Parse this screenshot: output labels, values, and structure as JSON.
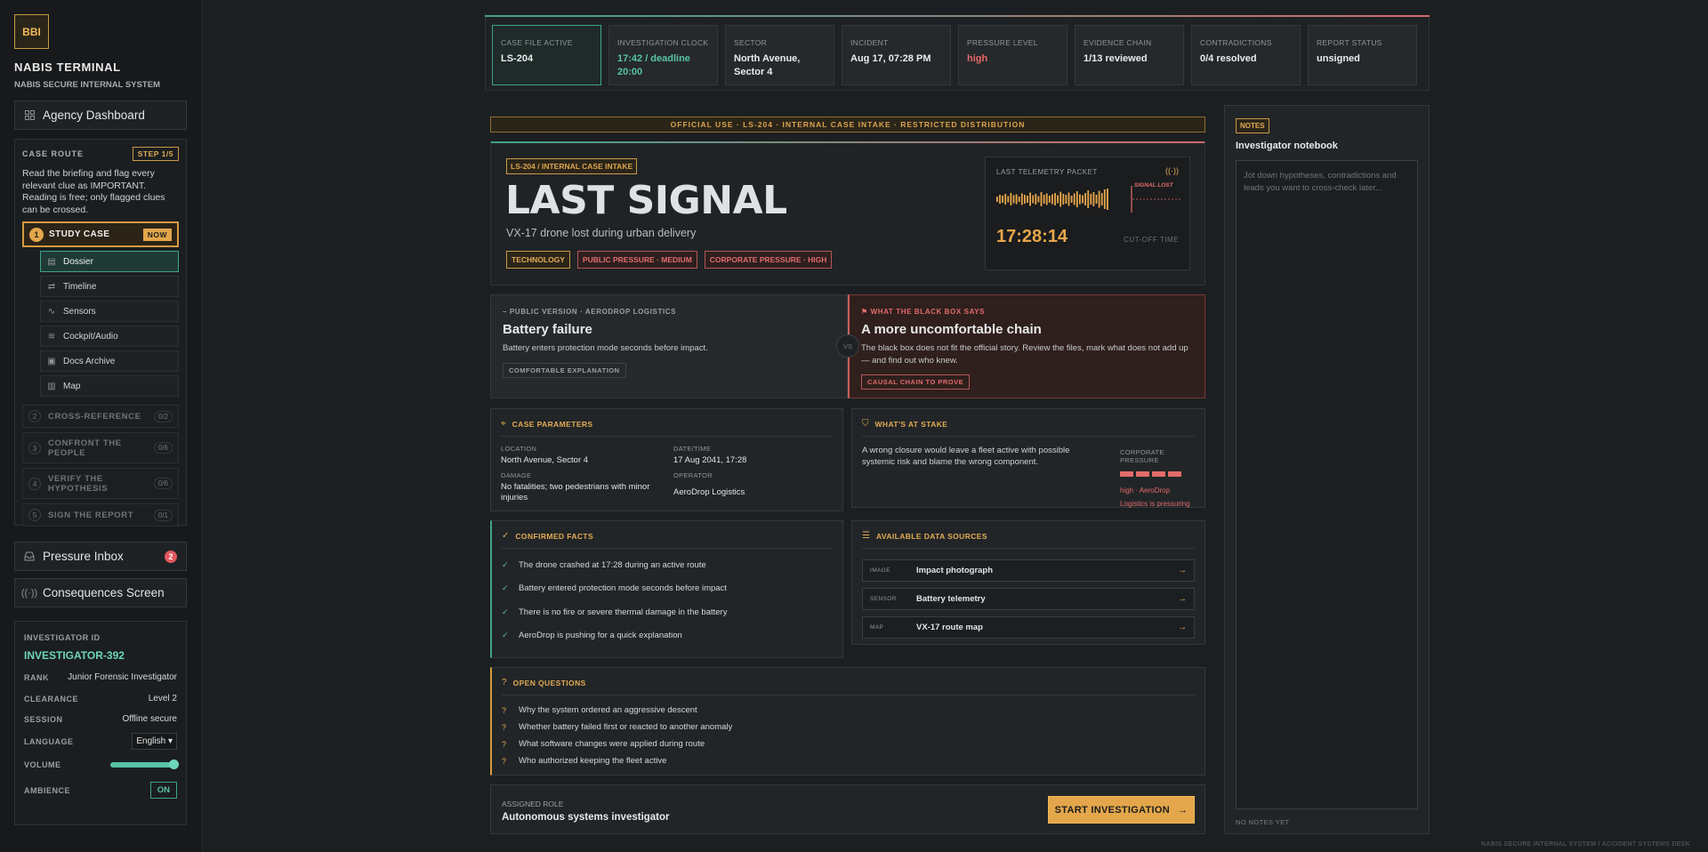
{
  "app": {
    "logo": "BBI",
    "title": "NABIS TERMINAL",
    "subtitle": "NABIS SECURE INTERNAL SYSTEM",
    "footer": "NABIS SECURE INTERNAL SYSTEM / ACCIDENT SYSTEMS DESK"
  },
  "sidebar": {
    "agency_dashboard": "Agency Dashboard",
    "pressure_inbox": "Pressure Inbox",
    "pressure_inbox_count": "2",
    "consequences": "Consequences Screen",
    "case_route": {
      "label": "CASE ROUTE",
      "step_badge": "STEP 1/5",
      "description": "Read the briefing and flag every relevant clue as IMPORTANT. Reading is free; only flagged clues can be crossed.",
      "active_step": {
        "num": "1",
        "label": "STUDY CASE",
        "badge": "NOW"
      },
      "subitems": [
        {
          "label": "Dossier"
        },
        {
          "label": "Timeline"
        },
        {
          "label": "Sensors"
        },
        {
          "label": "Cockpit/Audio"
        },
        {
          "label": "Docs Archive"
        },
        {
          "label": "Map"
        }
      ],
      "locked_steps": [
        {
          "num": "2",
          "label": "CROSS-REFERENCE",
          "count": "0/2"
        },
        {
          "num": "3",
          "label": "CONFRONT THE PEOPLE",
          "count": "0/6"
        },
        {
          "num": "4",
          "label": "VERIFY THE HYPOTHESIS",
          "count": "0/6"
        },
        {
          "num": "5",
          "label": "SIGN THE REPORT",
          "count": "0/1"
        }
      ]
    },
    "investigator": {
      "id_label": "INVESTIGATOR ID",
      "id": "INVESTIGATOR-392",
      "rank_label": "RANK",
      "rank": "Junior Forensic Investigator",
      "clearance_label": "CLEARANCE",
      "clearance": "Level 2",
      "session_label": "SESSION",
      "session": "Offline secure",
      "language_label": "LANGUAGE",
      "language": "English",
      "volume_label": "VOLUME",
      "volume": 1.0,
      "ambience_label": "AMBIENCE",
      "ambience": "ON"
    }
  },
  "topbar": [
    {
      "key": "CASE FILE ACTIVE",
      "value": "LS-204",
      "style": "normal"
    },
    {
      "key": "INVESTIGATION CLOCK",
      "value": "17:42 / deadline 20:00",
      "style": "teal"
    },
    {
      "key": "SECTOR",
      "value": "North Avenue, Sector 4",
      "style": "normal"
    },
    {
      "key": "INCIDENT",
      "value": "Aug 17, 07:28 PM",
      "style": "normal"
    },
    {
      "key": "PRESSURE LEVEL",
      "value": "high",
      "style": "red"
    },
    {
      "key": "EVIDENCE CHAIN",
      "value": "1/13 reviewed",
      "style": "normal"
    },
    {
      "key": "CONTRADICTIONS",
      "value": "0/4 resolved",
      "style": "normal"
    },
    {
      "key": "REPORT STATUS",
      "value": "unsigned",
      "style": "normal"
    }
  ],
  "banner": "OFFICIAL USE · LS-204 · INTERNAL CASE INTAKE · RESTRICTED DISTRIBUTION",
  "hero": {
    "tag": "LS-204 / INTERNAL CASE INTAKE",
    "title": "LAST SIGNAL",
    "subtitle": "VX-17 drone lost during urban delivery",
    "tags": [
      "TECHNOLOGY",
      "PUBLIC PRESSURE · MEDIUM",
      "CORPORATE PRESSURE · HIGH"
    ],
    "telemetry": {
      "label": "LAST TELEMETRY PACKET",
      "lost": "SIGNAL LOST",
      "time": "17:28:14",
      "cut_label": "CUT-OFF TIME"
    }
  },
  "versions": {
    "public": {
      "kicker": "PUBLIC VERSION · AERODROP LOGISTICS",
      "title": "Battery failure",
      "text": "Battery enters protection mode seconds before impact.",
      "pill": "COMFORTABLE EXPLANATION"
    },
    "vs": "VS",
    "blackbox": {
      "kicker": "WHAT THE BLACK BOX SAYS",
      "title": "A more uncomfortable chain",
      "text": "The black box does not fit the official story. Review the files, mark what does not add up — and find out who knew.",
      "pill": "CAUSAL CHAIN TO PROVE"
    }
  },
  "case_parameters": {
    "title": "CASE PARAMETERS",
    "location_label": "LOCATION",
    "location": "North Avenue, Sector 4",
    "datetime_label": "DATE/TIME",
    "datetime": "17 Aug 2041, 17:28",
    "damage_label": "DAMAGE",
    "damage": "No fatalities; two pedestrians with minor injuries",
    "operator_label": "OPERATOR",
    "operator": "AeroDrop Logistics"
  },
  "stake": {
    "title": "WHAT'S AT STAKE",
    "text": "A wrong closure would leave a fleet active with possible systemic risk and blame the wrong component.",
    "pressure_label": "CORPORATE PRESSURE",
    "pressure_level": 4,
    "pressure_max": 4,
    "pressure_text": "high · AeroDrop Logistics is pressuring"
  },
  "facts": {
    "title": "CONFIRMED FACTS",
    "items": [
      "The drone crashed at 17:28 during an active route",
      "Battery entered protection mode seconds before impact",
      "There is no fire or severe thermal damage in the battery",
      "AeroDrop is pushing for a quick explanation"
    ]
  },
  "sources": {
    "title": "AVAILABLE DATA SOURCES",
    "items": [
      {
        "kind": "IMAGE",
        "label": "Impact photograph"
      },
      {
        "kind": "SENSOR",
        "label": "Battery telemetry"
      },
      {
        "kind": "MAP",
        "label": "VX-17 route map"
      }
    ]
  },
  "questions": {
    "title": "OPEN QUESTIONS",
    "items": [
      "Why the system ordered an aggressive descent",
      "Whether battery failed first or reacted to another anomaly",
      "What software changes were applied during route",
      "Who authorized keeping the fleet active"
    ]
  },
  "role": {
    "label": "ASSIGNED ROLE",
    "value": "Autonomous systems investigator",
    "start": "START INVESTIGATION"
  },
  "notes": {
    "tag": "NOTES",
    "title": "Investigator notebook",
    "placeholder": "Jot down hypotheses, contradictions and leads you want to cross-check later...",
    "footer": "NO NOTES YET"
  },
  "colors": {
    "accent": "#e4a64a",
    "teal": "#58c3a7",
    "danger": "#e26b6b"
  }
}
